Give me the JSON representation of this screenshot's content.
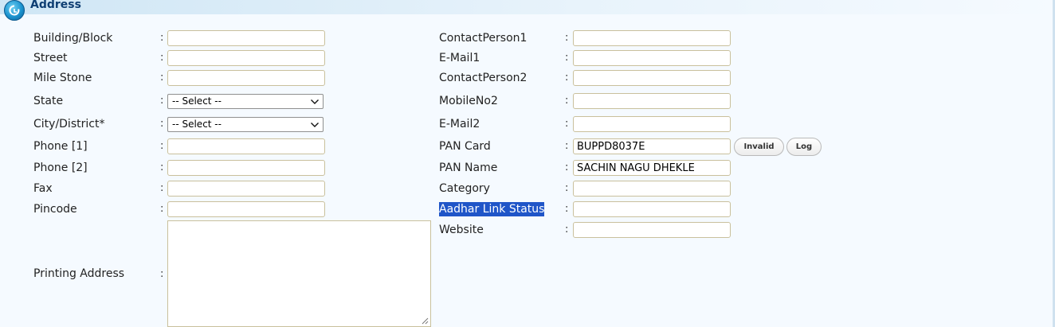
{
  "section": {
    "title": "Address",
    "icon": "refresh-circle-icon"
  },
  "left_fields": [
    {
      "label": "Building/Block",
      "value": ""
    },
    {
      "label": "Street",
      "value": ""
    },
    {
      "label": "Mile Stone",
      "value": ""
    },
    {
      "label": "State",
      "type": "select",
      "selected": "-- Select --"
    },
    {
      "label": "City/District*",
      "type": "select",
      "selected": "-- Select --"
    },
    {
      "label": "Phone [1]",
      "value": ""
    },
    {
      "label": "Phone [2]",
      "value": ""
    },
    {
      "label": "Fax",
      "value": ""
    },
    {
      "label": "Pincode",
      "value": ""
    },
    {
      "label": "Printing Address",
      "type": "textarea",
      "value": ""
    }
  ],
  "right_fields": [
    {
      "label": "ContactPerson1",
      "value": ""
    },
    {
      "label": "E-Mail1",
      "value": ""
    },
    {
      "label": "ContactPerson2",
      "value": ""
    },
    {
      "label": "MobileNo2",
      "value": ""
    },
    {
      "label": "E-Mail2",
      "value": ""
    },
    {
      "label": "PAN Card",
      "value": "BUPPD8037E"
    },
    {
      "label": "PAN Name",
      "value": "SACHIN NAGU DHEKLE"
    },
    {
      "label": "Category",
      "value": ""
    },
    {
      "label": "Aadhar Link Status",
      "value": "",
      "highlighted": true
    },
    {
      "label": "Website",
      "value": ""
    }
  ],
  "colon": ":",
  "pan_buttons": {
    "invalid": "Invalid",
    "log": "Log"
  },
  "colors": {
    "header_title": "#0e3e73",
    "page_bg": "#f5faff",
    "selection_highlight": "#1f55c8",
    "input_border": "#c9c09c"
  }
}
